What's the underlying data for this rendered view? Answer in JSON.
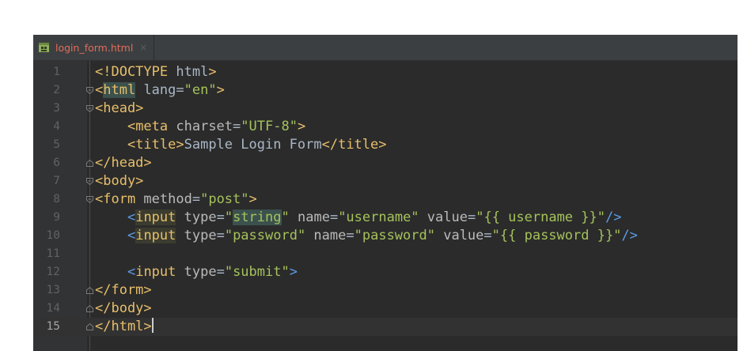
{
  "tab": {
    "label": "login_form.html",
    "close": "×",
    "icon": "html-file-icon"
  },
  "colors": {
    "editor_bg": "#2b2b2b",
    "gutter_bg": "#313335",
    "tag": "#e8bf6a",
    "string": "#a5c25c",
    "attribute": "#bababa",
    "tab_label": "#e06c5a"
  },
  "editor": {
    "current_line": 15,
    "lines": [
      {
        "n": "1",
        "fold": "",
        "tokens": [
          {
            "t": "<!DOCTYPE ",
            "c": "tag"
          },
          {
            "t": "html",
            "c": "plain"
          },
          {
            "t": ">",
            "c": "tag"
          }
        ]
      },
      {
        "n": "2",
        "fold": "open",
        "tokens": [
          {
            "t": "<",
            "c": "tag"
          },
          {
            "t": "html",
            "c": "tag",
            "hl": "1"
          },
          {
            "t": " lang",
            "c": "plain"
          },
          {
            "t": "=",
            "c": "plain"
          },
          {
            "t": "\"en\"",
            "c": "str"
          },
          {
            "t": ">",
            "c": "tag"
          }
        ]
      },
      {
        "n": "3",
        "fold": "open",
        "tokens": [
          {
            "t": "<head>",
            "c": "tag"
          }
        ]
      },
      {
        "n": "4",
        "fold": "",
        "tokens": [
          {
            "t": "    ",
            "c": "plain"
          },
          {
            "t": "<meta ",
            "c": "tag"
          },
          {
            "t": "charset",
            "c": "attr"
          },
          {
            "t": "=",
            "c": "plain"
          },
          {
            "t": "\"UTF-8\"",
            "c": "str"
          },
          {
            "t": ">",
            "c": "tag"
          }
        ]
      },
      {
        "n": "5",
        "fold": "",
        "tokens": [
          {
            "t": "    ",
            "c": "plain"
          },
          {
            "t": "<title>",
            "c": "tag"
          },
          {
            "t": "Sample Login Form",
            "c": "plain"
          },
          {
            "t": "</title>",
            "c": "tag"
          }
        ]
      },
      {
        "n": "6",
        "fold": "close",
        "tokens": [
          {
            "t": "</head>",
            "c": "tag"
          }
        ]
      },
      {
        "n": "7",
        "fold": "open",
        "tokens": [
          {
            "t": "<body>",
            "c": "tag"
          }
        ]
      },
      {
        "n": "8",
        "fold": "open",
        "tokens": [
          {
            "t": "<form ",
            "c": "tag"
          },
          {
            "t": "method",
            "c": "attr"
          },
          {
            "t": "=",
            "c": "plain"
          },
          {
            "t": "\"post\"",
            "c": "str"
          },
          {
            "t": ">",
            "c": "tag"
          }
        ]
      },
      {
        "n": "9",
        "fold": "",
        "tokens": [
          {
            "t": "    ",
            "c": "plain"
          },
          {
            "t": "<",
            "c": "blue"
          },
          {
            "t": "input",
            "c": "tag",
            "hl": "2"
          },
          {
            "t": " type",
            "c": "attr"
          },
          {
            "t": "=",
            "c": "plain"
          },
          {
            "t": "\"",
            "c": "str"
          },
          {
            "t": "string",
            "c": "str",
            "hl": "1"
          },
          {
            "t": "\"",
            "c": "str"
          },
          {
            "t": " name",
            "c": "attr"
          },
          {
            "t": "=",
            "c": "plain"
          },
          {
            "t": "\"username\"",
            "c": "str"
          },
          {
            "t": " value",
            "c": "attr"
          },
          {
            "t": "=",
            "c": "plain"
          },
          {
            "t": "\"{{ username }}\"",
            "c": "str"
          },
          {
            "t": "/>",
            "c": "blue"
          }
        ]
      },
      {
        "n": "10",
        "fold": "",
        "tokens": [
          {
            "t": "    ",
            "c": "plain"
          },
          {
            "t": "<",
            "c": "blue"
          },
          {
            "t": "input",
            "c": "tag",
            "hl": "2"
          },
          {
            "t": " type",
            "c": "attr"
          },
          {
            "t": "=",
            "c": "plain"
          },
          {
            "t": "\"password\"",
            "c": "str"
          },
          {
            "t": " name",
            "c": "attr"
          },
          {
            "t": "=",
            "c": "plain"
          },
          {
            "t": "\"password\"",
            "c": "str"
          },
          {
            "t": " value",
            "c": "attr"
          },
          {
            "t": "=",
            "c": "plain"
          },
          {
            "t": "\"{{ password }}\"",
            "c": "str"
          },
          {
            "t": "/>",
            "c": "blue"
          }
        ]
      },
      {
        "n": "11",
        "fold": "",
        "tokens": []
      },
      {
        "n": "12",
        "fold": "",
        "tokens": [
          {
            "t": "    ",
            "c": "plain"
          },
          {
            "t": "<",
            "c": "blue"
          },
          {
            "t": "input ",
            "c": "tag"
          },
          {
            "t": "type",
            "c": "attr"
          },
          {
            "t": "=",
            "c": "plain"
          },
          {
            "t": "\"submit\"",
            "c": "str"
          },
          {
            "t": ">",
            "c": "blue"
          }
        ]
      },
      {
        "n": "13",
        "fold": "close",
        "tokens": [
          {
            "t": "</form>",
            "c": "tag"
          }
        ]
      },
      {
        "n": "14",
        "fold": "close",
        "tokens": [
          {
            "t": "</body>",
            "c": "tag"
          }
        ]
      },
      {
        "n": "15",
        "fold": "close",
        "tokens": [
          {
            "t": "</html>",
            "c": "tag"
          }
        ]
      }
    ]
  }
}
